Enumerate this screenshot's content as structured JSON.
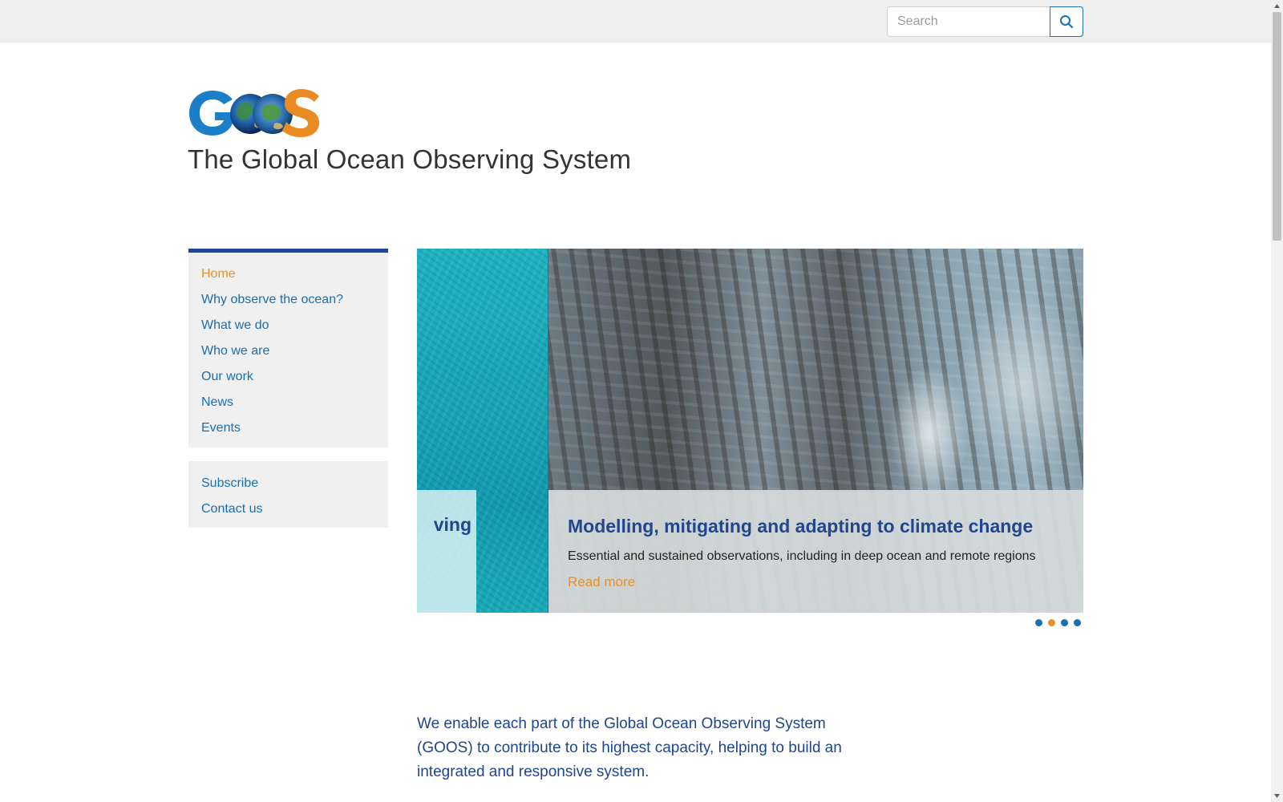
{
  "search": {
    "placeholder": "Search",
    "icon": "search-icon"
  },
  "header": {
    "logo_text": "GOOS",
    "site_title": "The Global Ocean Observing System"
  },
  "nav": {
    "primary": [
      {
        "label": "Home",
        "active": true
      },
      {
        "label": "Why observe the ocean?",
        "active": false
      },
      {
        "label": "What we do",
        "active": false
      },
      {
        "label": "Who we are",
        "active": false
      },
      {
        "label": "Our work",
        "active": false
      },
      {
        "label": "News",
        "active": false
      },
      {
        "label": "Events",
        "active": false
      }
    ],
    "secondary": [
      {
        "label": "Subscribe"
      },
      {
        "label": "Contact us"
      }
    ]
  },
  "slider": {
    "prev_slide": {
      "title_fragment": "ving"
    },
    "current_slide": {
      "title": "Modelling, mitigating and adapting to climate change",
      "text": "Essential and sustained observations, including in deep ocean and remote regions",
      "link": "Read more"
    },
    "dots": {
      "count": 4,
      "active_index": 1
    }
  },
  "intro": {
    "text": "We enable each part of the Global Ocean Observing System (GOOS) to contribute to its highest capacity, helping to build an integrated and responsive system."
  },
  "colors": {
    "brand_blue": "#20468f",
    "link_blue": "#1a6fb0",
    "accent_orange": "#e8902a",
    "panel_gray": "#f0f0f0"
  }
}
